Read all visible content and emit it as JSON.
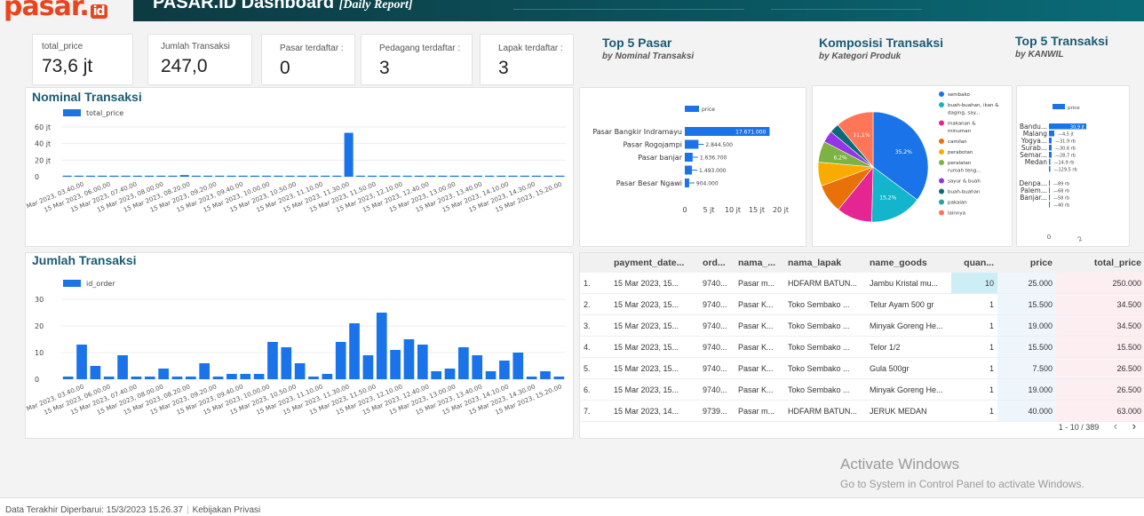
{
  "header": {
    "logo_text": "pasar.",
    "logo_badge": "id",
    "title": "PASAR.ID Dashboard",
    "title_suffix": "[Daily Report]",
    "bg_color": "#0e3a41",
    "accent_color": "#e8451e"
  },
  "kpis": [
    {
      "label": "total_price",
      "value": "73,6 jt"
    },
    {
      "label": "Jumlah Transaksi",
      "value": "247,0"
    },
    {
      "label": "Pasar terdaftar :",
      "value": "0"
    },
    {
      "label": "Pedagang terdaftar :",
      "value": "3"
    },
    {
      "label": "Lapak terdaftar :",
      "value": "3"
    }
  ],
  "sections": {
    "top5_pasar": {
      "title": "Top 5 Pasar",
      "subtitle": "by  Nominal Transaksi"
    },
    "komposisi": {
      "title": "Komposisi Transaksi",
      "subtitle": "by  Kategori Produk"
    },
    "top5_transaksi": {
      "title": "Top 5 Transaksi",
      "subtitle": "by  KANWIL"
    },
    "nominal": {
      "title": "Nominal Transaksi"
    },
    "jumlah": {
      "title": "Jumlah Transaksi"
    }
  },
  "chart_data": [
    {
      "id": "nominal_transaksi",
      "type": "bar",
      "title": "Nominal Transaksi",
      "legend": "total_price",
      "y_ticks": [
        "0",
        "20 jt",
        "40 jt",
        "60 jt"
      ],
      "ylim": [
        0,
        60000000
      ],
      "x_labels": [
        "15 Mar 2023, 03.40.00",
        "15 Mar 2023, 06.00.00",
        "15 Mar 2023, 07.40.00",
        "15 Mar 2023, 08.00.00",
        "15 Mar 2023, 08.20.00",
        "15 Mar 2023, 09.20.00",
        "15 Mar 2023, 09.40.00",
        "15 Mar 2023, 10.00.00",
        "15 Mar 2023, 10.50.00",
        "15 Mar 2023, 11.10.00",
        "15 Mar 2023, 11.30.00",
        "15 Mar 2023, 11.50.00",
        "15 Mar 2023, 12.10.00",
        "15 Mar 2023, 12.40.00",
        "15 Mar 2023, 13.00.00",
        "15 Mar 2023, 13.40.00",
        "15 Mar 2023, 14.10.00",
        "15 Mar 2023, 14.30.00",
        "15 Mar 2023, 15.20.00"
      ],
      "values": [
        300000,
        600000,
        100000,
        200000,
        150000,
        300000,
        100000,
        100000,
        200000,
        150000,
        2000000,
        100000,
        300000,
        100000,
        200000,
        250000,
        400000,
        600000,
        300000,
        100000,
        150000,
        200000,
        250000,
        400000,
        53000000,
        300000,
        100000,
        200000,
        150000,
        300000,
        200000,
        250000,
        100000,
        300000,
        200000,
        150000,
        100000,
        200000,
        300000,
        150000,
        100000,
        200000,
        100000
      ]
    },
    {
      "id": "jumlah_transaksi",
      "type": "bar",
      "title": "Jumlah Transaksi",
      "legend": "id_order",
      "y_ticks": [
        "0",
        "10",
        "20",
        "30"
      ],
      "ylim": [
        0,
        30
      ],
      "x_labels": [
        "15 Mar 2023, 03.40.00",
        "15 Mar 2023, 06.00.00",
        "15 Mar 2023, 07.40.00",
        "15 Mar 2023, 08.00.00",
        "15 Mar 2023, 08.20.00",
        "15 Mar 2023, 09.20.00",
        "15 Mar 2023, 09.40.00",
        "15 Mar 2023, 10.00.00",
        "15 Mar 2023, 10.50.00",
        "15 Mar 2023, 11.10.00",
        "15 Mar 2023, 11.30.00",
        "15 Mar 2023, 11.50.00",
        "15 Mar 2023, 12.10.00",
        "15 Mar 2023, 12.40.00",
        "15 Mar 2023, 13.00.00",
        "15 Mar 2023, 13.40.00",
        "15 Mar 2023, 14.10.00",
        "15 Mar 2023, 14.30.00",
        "15 Mar 2023, 15.20.00"
      ],
      "values": [
        1,
        13,
        5,
        1,
        9,
        1,
        1,
        4,
        1,
        1,
        6,
        1,
        2,
        2,
        2,
        14,
        12,
        6,
        1,
        2,
        14,
        21,
        9,
        25,
        11,
        15,
        13,
        3,
        4,
        12,
        9,
        3,
        7,
        10,
        1,
        3,
        1
      ]
    },
    {
      "id": "top5_pasar",
      "type": "bar",
      "orientation": "horizontal",
      "legend": "price",
      "categories": [
        "Pasar Bangkir Indramayu",
        "Pasar Rogojampi",
        "Pasar banjar",
        "",
        "Pasar Besar Ngawi"
      ],
      "values": [
        17671000,
        2844500,
        1636700,
        1493000,
        904000
      ],
      "data_labels": [
        "17.671.000",
        "2.844.500",
        "1.636.700",
        "1.493.000",
        "904.000"
      ],
      "x_ticks": [
        "0",
        "5 jt",
        "10 jt",
        "15 jt",
        "20 jt"
      ],
      "xlim": [
        0,
        20000000
      ]
    },
    {
      "id": "komposisi_transaksi",
      "type": "pie",
      "slices": [
        {
          "label": "sembako",
          "value": 35.2,
          "color": "#1a73e8",
          "text": "35,2%"
        },
        {
          "label": "buah-buahan, ikan & daging, sayu...",
          "value": 15.2,
          "color": "#12b5cb",
          "text": "15,2%"
        },
        {
          "label": "makanan & minuman",
          "value": 10.5,
          "color": "#e52592",
          "text": ""
        },
        {
          "label": "camilan",
          "value": 8.5,
          "color": "#e8710a",
          "text": ""
        },
        {
          "label": "perabotan",
          "value": 7.0,
          "color": "#f9ab00",
          "text": ""
        },
        {
          "label": "peralatan rumah tang...",
          "value": 6.2,
          "color": "#7cb342",
          "text": "6,2%"
        },
        {
          "label": "sayur & buah",
          "value": 3.5,
          "color": "#9334e6",
          "text": ""
        },
        {
          "label": "buah-buahan",
          "value": 2.8,
          "color": "#0a6b77",
          "text": ""
        },
        {
          "label": "pakaian",
          "value": 0.0,
          "color": "#26a69a",
          "text": ""
        },
        {
          "label": "lainnya",
          "value": 11.1,
          "color": "#ff7557",
          "text": "11,1%"
        }
      ],
      "legend_labels": [
        "sembako",
        "buah-buahan, ikan &",
        "daging, say...",
        "makanan &",
        "minuman",
        "camilan",
        "perabotan",
        "peralatan",
        "rumah teng...",
        "sayur & buah",
        "buah-buahan",
        "pakaian",
        "lainnya"
      ]
    },
    {
      "id": "top5_transaksi",
      "type": "bar",
      "orientation": "horizontal",
      "legend": "price",
      "categories": [
        "Bandu...",
        "Malang",
        "Yogya...",
        "Surab...",
        "Semar...",
        "Medan",
        "",
        "Denpa...",
        "Palem...",
        "Banjar..."
      ],
      "values": [
        30900,
        4500,
        31900,
        30600,
        28700,
        14900,
        12950,
        8900,
        6800,
        5800,
        4000
      ],
      "data_labels": [
        "30,9 jt",
        "4,5 jt",
        "31,9 rb",
        "30,6 rb",
        "28,7 rb",
        "14,9 rb",
        "129,5 rb",
        "89 rb",
        "68 rb",
        "58 rb",
        "40 rb"
      ],
      "x_ticks": [
        "0",
        "2"
      ]
    }
  ],
  "table": {
    "columns": [
      "",
      "payment_date...",
      "ord...",
      "nama_...",
      "nama_lapak",
      "name_goods",
      "quan...",
      "price",
      "total_price"
    ],
    "rows": [
      [
        "1.",
        "15 Mar 2023, 15...",
        "9740...",
        "Pasar m...",
        "HDFARM BATUN...",
        "Jambu Kristal mu...",
        "10",
        "25.000",
        "250.000"
      ],
      [
        "2.",
        "15 Mar 2023, 15...",
        "9740...",
        "Pasar K...",
        "Toko Sembako ...",
        "Telur Ayam 500 gr",
        "1",
        "15.500",
        "34.500"
      ],
      [
        "3.",
        "15 Mar 2023, 15...",
        "9740...",
        "Pasar K...",
        "Toko Sembako ...",
        "Minyak Goreng He...",
        "1",
        "19.000",
        "34.500"
      ],
      [
        "4.",
        "15 Mar 2023, 15...",
        "9740...",
        "Pasar K...",
        "Toko Sembako ...",
        "Telor 1/2",
        "1",
        "15.500",
        "15.500"
      ],
      [
        "5.",
        "15 Mar 2023, 15...",
        "9740...",
        "Pasar K...",
        "Toko Sembako ...",
        "Gula 500gr",
        "1",
        "7.500",
        "26.500"
      ],
      [
        "6.",
        "15 Mar 2023, 15...",
        "9740...",
        "Pasar K...",
        "Toko Sembako ...",
        "Minyak Goreng He...",
        "1",
        "19.000",
        "26.500"
      ],
      [
        "7.",
        "15 Mar 2023, 14...",
        "9739...",
        "Pasar m...",
        "HDFARM BATUN...",
        "JERUK MEDAN",
        "1",
        "40.000",
        "63.000"
      ]
    ],
    "pager": "1 - 10 / 389",
    "prev_icon": "‹",
    "next_icon": "›"
  },
  "watermark": {
    "line1": "Activate Windows",
    "line2": "Go to System in Control Panel to activate Windows."
  },
  "footer": {
    "updated": "Data Terakhir Diperbarui: 15/3/2023 15.26.37",
    "privacy": "Kebijakan Privasi"
  }
}
